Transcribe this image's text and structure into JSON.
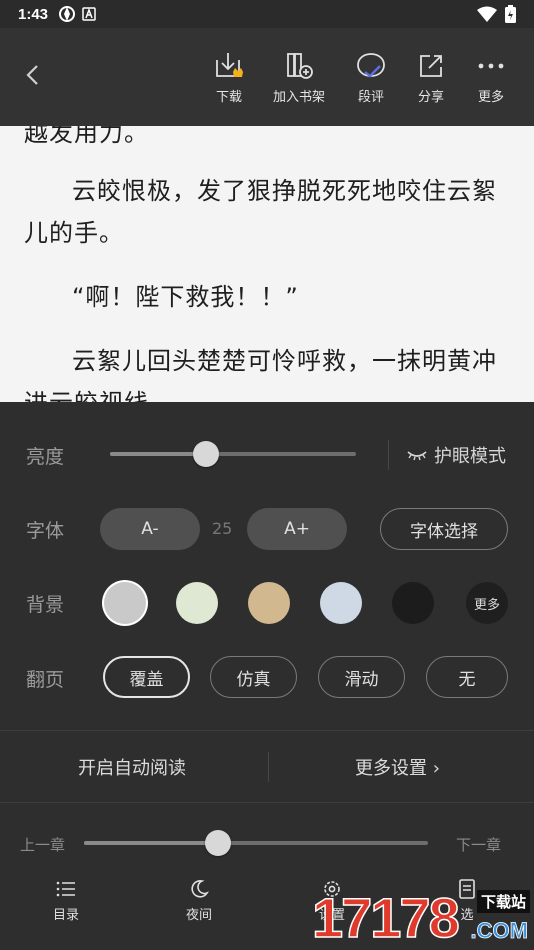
{
  "status_bar": {
    "time": "1:43"
  },
  "toolbar": {
    "download": "下载",
    "add_to_shelf": "加入书架",
    "paragraph_comment": "段评",
    "share": "分享",
    "more": "更多"
  },
  "reader": {
    "paragraphs": [
      "越发用力。",
      "云皎恨极，发了狠挣脱死死地咬住云絮儿的手。",
      "“啊！陛下救我！！”",
      "云絮儿回头楚楚可怜呼救，一抹明黄冲进云皎视线"
    ]
  },
  "settings": {
    "brightness_label": "亮度",
    "brightness_level": 0.39,
    "eye_mode_label": "护眼模式",
    "font_label": "字体",
    "font_decrease": "A-",
    "font_size": "25",
    "font_increase": "A+",
    "font_select": "字体选择",
    "background_label": "背景",
    "background_colors": [
      "#c9c9c9",
      "#dfe8d3",
      "#d2b88f",
      "#cfd9e6",
      "#1c1c1c"
    ],
    "background_more": "更多",
    "page_turn_label": "翻页",
    "page_turn_options": [
      "覆盖",
      "仿真",
      "滑动",
      "无"
    ],
    "page_turn_selected": "覆盖",
    "auto_read": "开启自动阅读",
    "more_settings": "更多设置 ›"
  },
  "chapter_nav": {
    "prev": "上一章",
    "next": "下一章",
    "progress": 0.39
  },
  "bottom_nav": {
    "toc": "目录",
    "night": "夜间",
    "settings": "设置",
    "fourth": "选"
  },
  "watermark": {
    "number": "17178",
    "tag": "下载站",
    "domain": ".COM"
  }
}
